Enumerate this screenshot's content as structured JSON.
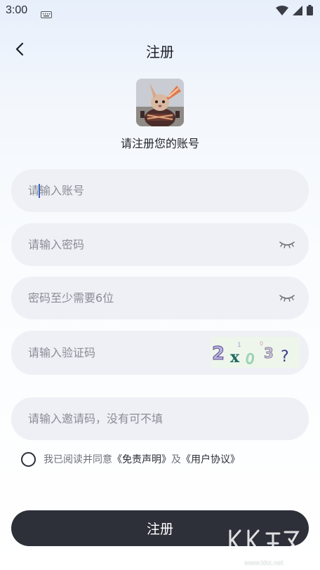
{
  "status_bar": {
    "time": "3:00"
  },
  "header": {
    "title": "注册"
  },
  "subtitle": "请注册您的账号",
  "form": {
    "account_placeholder": "请输入账号",
    "password_placeholder": "请输入密码",
    "confirm_placeholder": "密码至少需要6位",
    "captcha_placeholder": "请输入验证码",
    "captcha_text": [
      "2",
      "x",
      "0",
      "3",
      "?"
    ],
    "invite_placeholder": "请输入邀请码，没有可不填"
  },
  "agreement": {
    "prefix": "我已阅读并同意",
    "link1": "《免责声明》",
    "and": "及",
    "link2": "《用户协议》"
  },
  "submit_label": "注册",
  "watermark": {
    "text": "www.kkx.net"
  },
  "colors": {
    "button_bg": "#2d3039",
    "field_bg": "#eef0f5",
    "cursor": "#3b63c9"
  }
}
